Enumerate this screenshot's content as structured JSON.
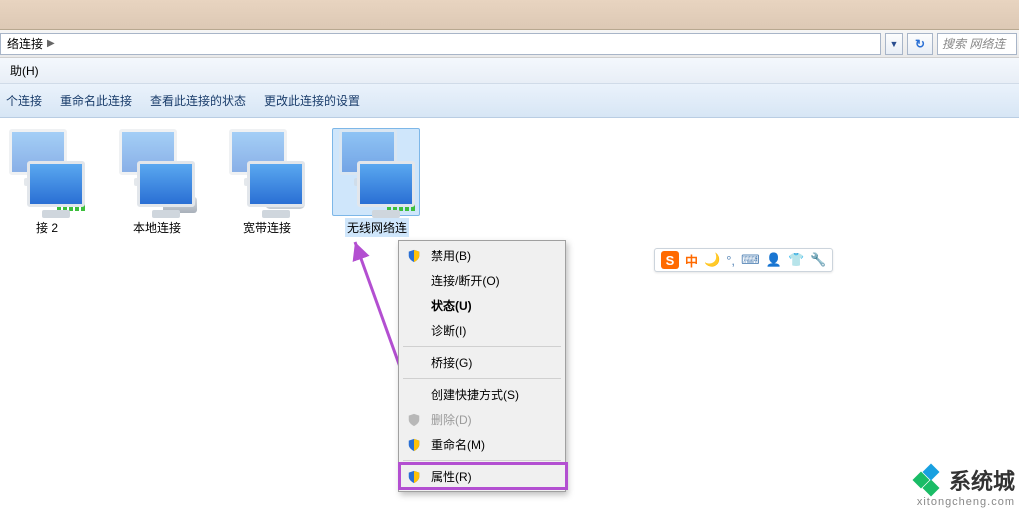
{
  "addressbar": {
    "crumb": "络连接",
    "arrow": "▶",
    "search_placeholder": "搜索 网络连"
  },
  "menubar": {
    "help": "助(H)"
  },
  "toolbar": {
    "item1": "个连接",
    "item2": "重命名此连接",
    "item3": "查看此连接的状态",
    "item4": "更改此连接的设置"
  },
  "connections": [
    {
      "label": "接 2"
    },
    {
      "label": "本地连接"
    },
    {
      "label": "宽带连接"
    },
    {
      "label": "无线网络连"
    }
  ],
  "context_menu": {
    "disable": "禁用(B)",
    "connect": "连接/断开(O)",
    "status": "状态(U)",
    "diagnose": "诊断(I)",
    "bridge": "桥接(G)",
    "shortcut": "创建快捷方式(S)",
    "delete": "删除(D)",
    "rename": "重命名(M)",
    "properties": "属性(R)"
  },
  "ime": {
    "s": "S",
    "cn": "中",
    "moon": "🌙",
    "punct": "°,",
    "kbd": "⌨",
    "user": "👤",
    "shirt": "👕",
    "wrench": "🔧"
  },
  "watermark": {
    "name": "系统城",
    "url": "xitongcheng.com"
  }
}
